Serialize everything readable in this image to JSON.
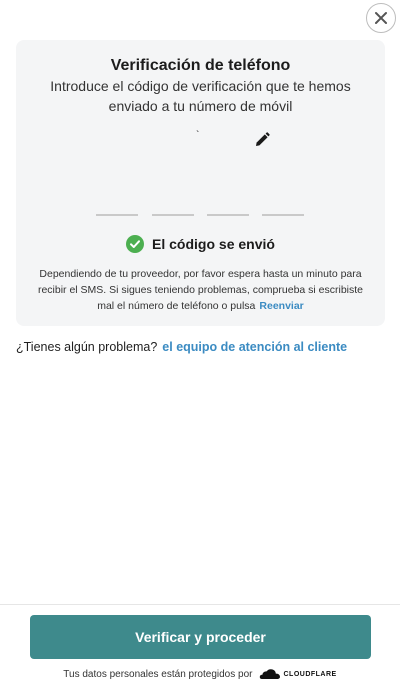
{
  "dialog": {
    "close_icon": "close-icon",
    "title": "Verificación de teléfono",
    "subtitle": "Introduce el código de verificación que te hemos enviado a tu número de móvil",
    "phone_number": "`",
    "edit_icon": "pencil-icon",
    "code_input_count": 4,
    "code_values": [
      "",
      "",
      "",
      ""
    ],
    "status": {
      "icon": "check-circle-icon",
      "text": "El código se envió",
      "color": "#4caf50"
    },
    "help_text": "Dependiendo de tu proveedor, por favor espera hasta un minuto para recibir el SMS. Si sigues teniendo problemas, comprueba si escribiste mal el número de teléfono o pulsa",
    "resend_label": "Reenviar"
  },
  "support": {
    "question": "¿Tienes algún problema?",
    "link_label": "el equipo de atención al cliente"
  },
  "footer": {
    "submit_label": "Verificar y proceder",
    "note": "Tus datos personales están protegidos por",
    "logo_text": "CLOUDFLARE",
    "logo_icon": "cloudflare-cloud-icon"
  },
  "colors": {
    "accent": "#3e8a8c",
    "link": "#3b8bc2",
    "card_bg": "#f4f5f6",
    "success": "#4caf50"
  }
}
